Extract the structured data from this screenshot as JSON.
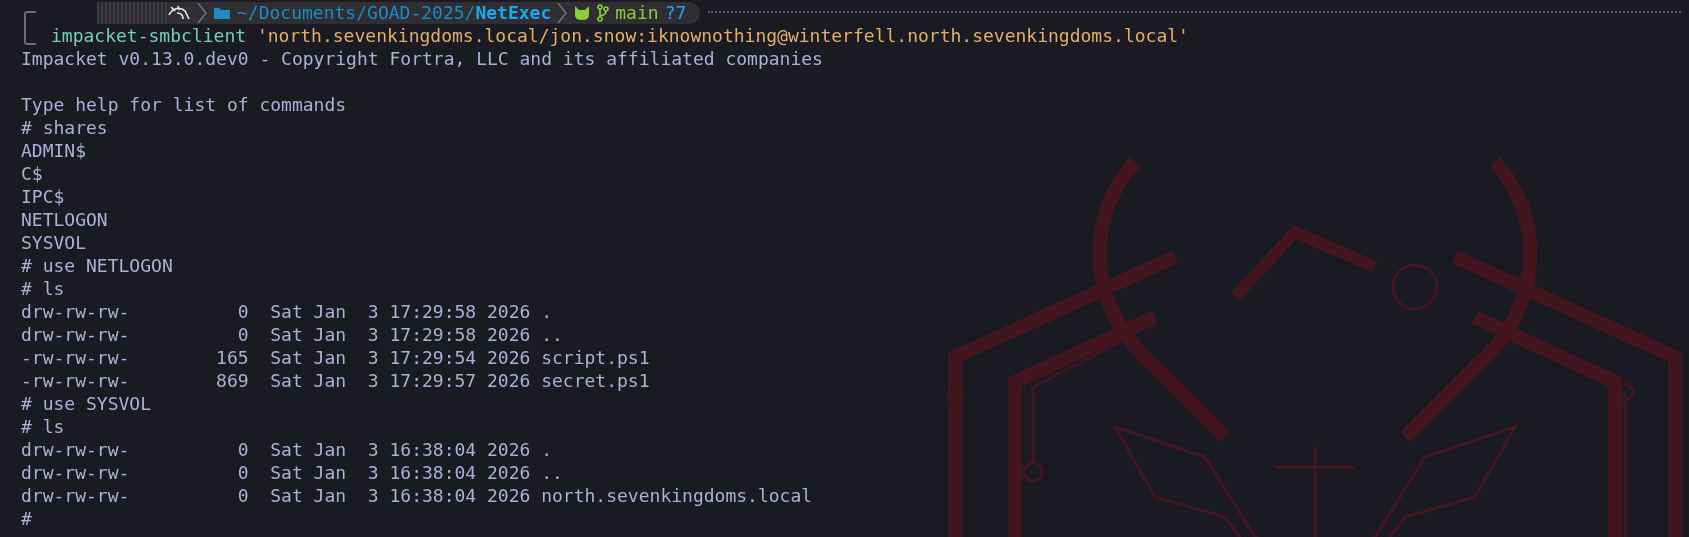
{
  "prompt": {
    "path_prefix": "~/Documents/GOAD-2025/",
    "path_current": "NetExec",
    "branch": "main",
    "status": "?7"
  },
  "command": {
    "program": "impacket-smbclient",
    "argument": "'north.sevenkingdoms.local/jon.snow:iknownothing@winterfell.north.sevenkingdoms.local'"
  },
  "output": [
    {
      "kind": "text",
      "text": "Impacket v0.13.0.dev0 - Copyright Fortra, LLC and its affiliated companies"
    },
    {
      "kind": "blank"
    },
    {
      "kind": "text",
      "text": "Type help for list of commands"
    },
    {
      "kind": "text",
      "text": "# shares"
    },
    {
      "kind": "text",
      "text": "ADMIN$"
    },
    {
      "kind": "text",
      "text": "C$"
    },
    {
      "kind": "text",
      "text": "IPC$"
    },
    {
      "kind": "text",
      "text": "NETLOGON"
    },
    {
      "kind": "text",
      "text": "SYSVOL"
    },
    {
      "kind": "text",
      "text": "# use NETLOGON"
    },
    {
      "kind": "text",
      "text": "# ls"
    },
    {
      "kind": "text",
      "text": "drw-rw-rw-          0  Sat Jan  3 17:29:58 2026 ."
    },
    {
      "kind": "text",
      "text": "drw-rw-rw-          0  Sat Jan  3 17:29:58 2026 .."
    },
    {
      "kind": "text",
      "text": "-rw-rw-rw-        165  Sat Jan  3 17:29:54 2026 script.ps1"
    },
    {
      "kind": "text",
      "text": "-rw-rw-rw-        869  Sat Jan  3 17:29:57 2026 secret.ps1"
    },
    {
      "kind": "text",
      "text": "# use SYSVOL"
    },
    {
      "kind": "text",
      "text": "# ls"
    },
    {
      "kind": "text",
      "text": "drw-rw-rw-          0  Sat Jan  3 16:38:04 2026 ."
    },
    {
      "kind": "text",
      "text": "drw-rw-rw-          0  Sat Jan  3 16:38:04 2026 .."
    },
    {
      "kind": "text",
      "text": "drw-rw-rw-          0  Sat Jan  3 16:38:04 2026 north.sevenkingdoms.local"
    },
    {
      "kind": "text",
      "text": "#"
    }
  ]
}
